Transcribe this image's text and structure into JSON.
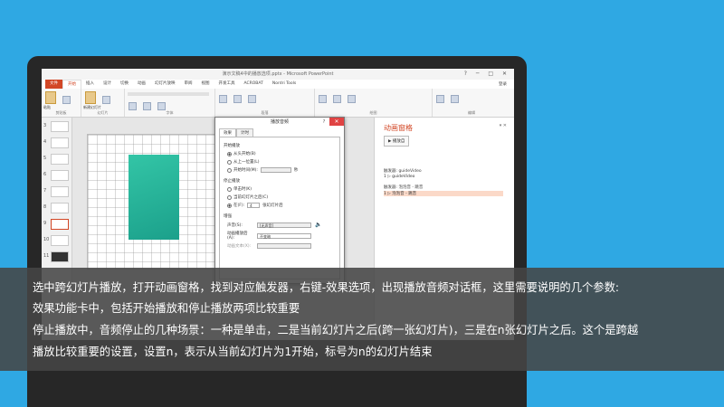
{
  "window": {
    "title": "演示文稿4中的播放选项.pptx - Microsoft PowerPoint",
    "controls": "? ─ □ ✕"
  },
  "ribbon": {
    "tabs": [
      "文件",
      "开始",
      "插入",
      "设计",
      "切换",
      "动画",
      "幻灯片放映",
      "审阅",
      "视图",
      "开发工具",
      "ACROBAT",
      "Nordri Tools"
    ],
    "active_tab": "开始",
    "user": "登录",
    "groups": [
      "剪贴板",
      "幻灯片",
      "字体",
      "段落",
      "绘图",
      "编辑"
    ],
    "paste_label": "粘贴",
    "new_slide_label": "新建幻灯片"
  },
  "thumbnails": [
    "3",
    "4",
    "5",
    "6",
    "7",
    "8",
    "9",
    "10",
    "11"
  ],
  "animation_pane": {
    "title": "动画窗格",
    "play_button": "▶ 播放自",
    "trigger1": "触发器: guideVideo",
    "item1": "1  ▷  guideVideo",
    "trigger2": "触发器: 泡泡音 - 跳音",
    "item2": "1  ▷  泡泡音 - 跳音"
  },
  "dialog": {
    "title": "播放音频",
    "help": "?",
    "close": "✕",
    "tabs": [
      "效果",
      "计时"
    ],
    "start_section": "开始播放",
    "start_options": [
      "从头开始(B)",
      "从上一位置(L)",
      "开始时间(M):"
    ],
    "seconds_unit": "秒",
    "stop_section": "停止播放",
    "stop_options": [
      "单击时(K)",
      "当前幻灯片之后(C)",
      "在(F):"
    ],
    "stop_count": "4",
    "stop_suffix": "张幻灯片后",
    "enhance_section": "增强",
    "sound_label": "声音(S):",
    "sound_value": "[无声音]",
    "after_anim_label": "动画播放后(A):",
    "after_anim_value": "不变暗",
    "text_anim_label": "动画文本(X):"
  },
  "caption": {
    "line1": "选中跨幻灯片播放，打开动画窗格，找到对应触发器，右键-效果选项，出现播放音频对话框，这里需要说明的几个参数:",
    "line2": "效果功能卡中，包括开始播放和停止播放两项比较重要",
    "line3": "停止播放中，音频停止的几种场景：一种是单击，二是当前幻灯片之后(跨一张幻灯片)，三是在n张幻灯片之后。这个是跨越",
    "line4": "播放比较重要的设置，设置n，表示从当前幻灯片为1开始，标号为n的幻灯片结束"
  },
  "colors": {
    "background": "#2fa8e3",
    "accent": "#d24726",
    "teal_shape": "#1fb094"
  }
}
